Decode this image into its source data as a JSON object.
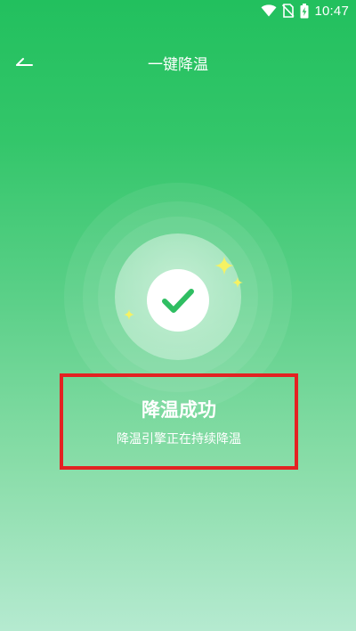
{
  "status_bar": {
    "time": "10:47",
    "icons": [
      "wifi-icon",
      "no-sim-icon",
      "battery-charging-icon"
    ]
  },
  "header": {
    "title": "一键降温",
    "back_icon": "back-arrow-icon"
  },
  "result": {
    "icon": "check-icon",
    "title": "降温成功",
    "subtitle": "降温引擎正在持续降温"
  },
  "colors": {
    "background_top": "#22c05e",
    "background_bottom": "#b5ead0",
    "check_green": "#2fbe62",
    "sparkle": "#f5f263",
    "highlight_box": "#e32222",
    "text": "#ffffff"
  }
}
